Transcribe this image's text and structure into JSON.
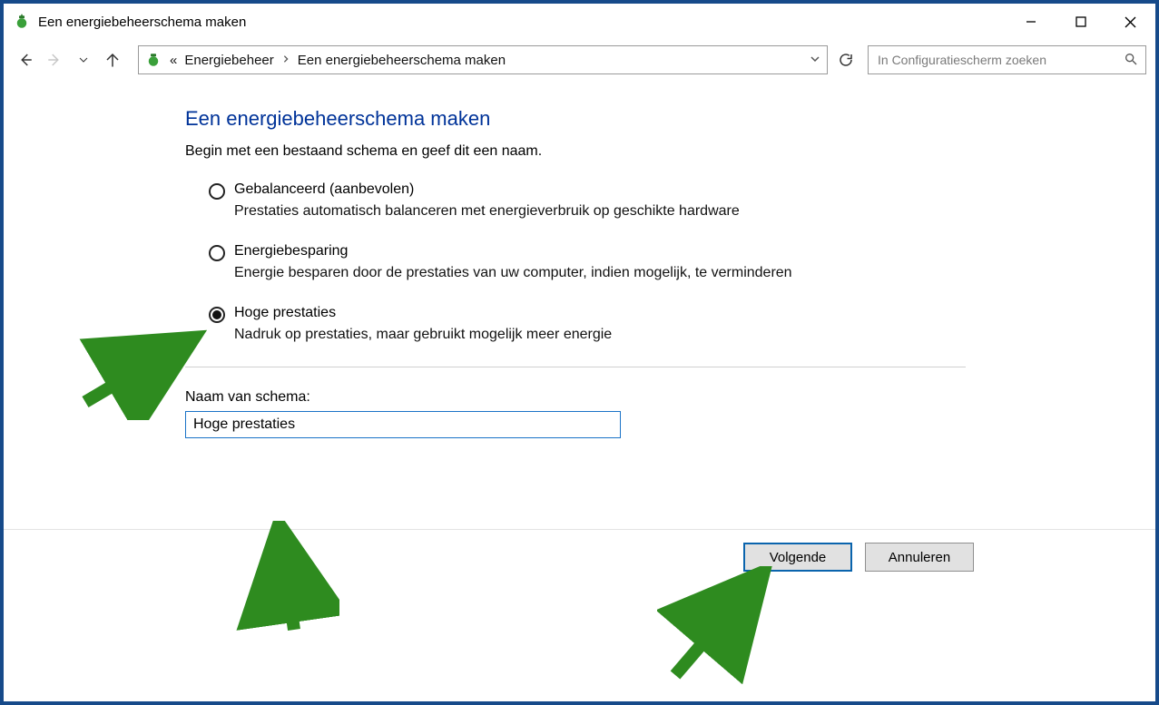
{
  "window": {
    "title": "Een energiebeheerschema maken"
  },
  "breadcrumb": {
    "prefix": "«",
    "items": [
      "Energiebeheer",
      "Een energiebeheerschema maken"
    ]
  },
  "search": {
    "placeholder": "In Configuratiescherm zoeken"
  },
  "page": {
    "heading": "Een energiebeheerschema maken",
    "subheading": "Begin met een bestaand schema en geef dit een naam."
  },
  "options": [
    {
      "label": "Gebalanceerd (aanbevolen)",
      "description": "Prestaties automatisch balanceren met energieverbruik op geschikte hardware",
      "checked": false
    },
    {
      "label": "Energiebesparing",
      "description": "Energie besparen door de prestaties van uw computer, indien mogelijk, te verminderen",
      "checked": false
    },
    {
      "label": "Hoge prestaties",
      "description": "Nadruk op prestaties, maar gebruikt mogelijk meer energie",
      "checked": true
    }
  ],
  "planName": {
    "label": "Naam van schema:",
    "value": "Hoge prestaties"
  },
  "buttons": {
    "next": "Volgende",
    "cancel": "Annuleren"
  }
}
